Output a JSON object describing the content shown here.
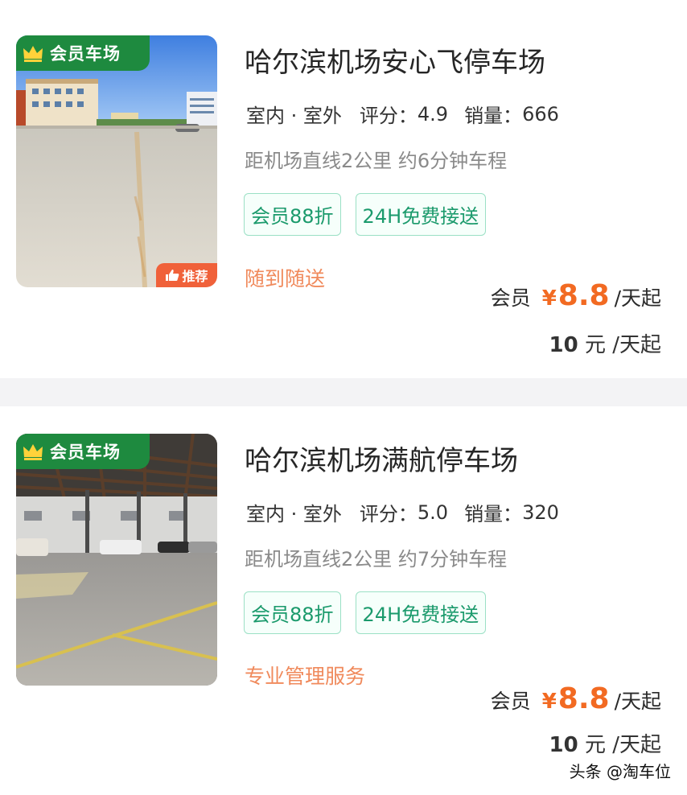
{
  "listings": [
    {
      "badge": "会员车场",
      "recommend": "推荐",
      "title": "哈尔滨机场安心飞停车场",
      "place": "室内 · 室外",
      "rating_label": "评分：",
      "rating": "4.9",
      "sales_label": "销量：",
      "sales": "666",
      "distance": "距机场直线2公里 约6分钟车程",
      "tags": [
        "会员88折",
        "24H免费接送"
      ],
      "feature": "随到随送",
      "member_label": "会员",
      "currency": "¥",
      "member_price": "8.8",
      "per_day": "/天起",
      "original_price": "10",
      "original_unit": "元 /天起"
    },
    {
      "badge": "会员车场",
      "title": "哈尔滨机场满航停车场",
      "place": "室内 · 室外",
      "rating_label": "评分：",
      "rating": "5.0",
      "sales_label": "销量：",
      "sales": "320",
      "distance": "距机场直线2公里 约7分钟车程",
      "tags": [
        "会员88折",
        "24H免费接送"
      ],
      "feature": "专业管理服务",
      "member_label": "会员",
      "currency": "¥",
      "member_price": "8.8",
      "per_day": "/天起",
      "original_price": "10",
      "original_unit": "元 /天起"
    }
  ],
  "watermark": "头条 @淘车位",
  "colors": {
    "badge_green": "#1e8a3f",
    "price_orange": "#f26a22",
    "tag_green": "#1b9a6c",
    "feature_orange": "#f08a5c"
  }
}
